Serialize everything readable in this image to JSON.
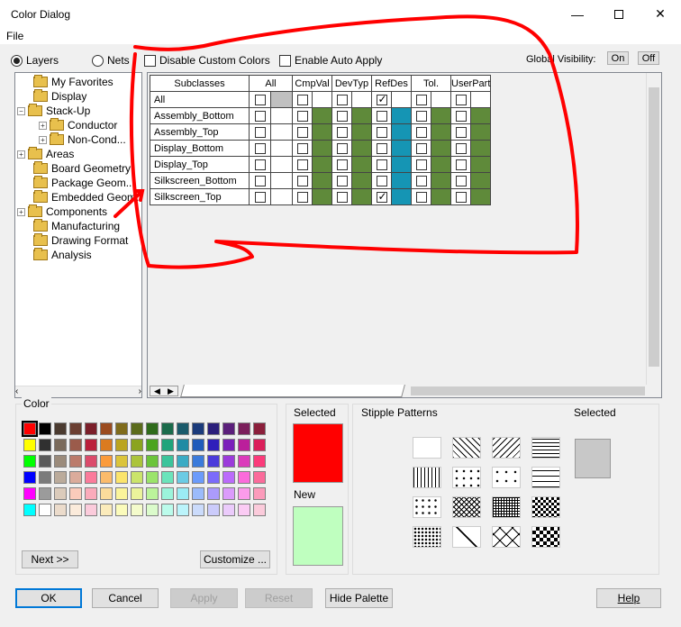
{
  "window": {
    "title": "Color Dialog"
  },
  "menu": {
    "file": "File"
  },
  "top": {
    "layers": "Layers",
    "nets": "Nets",
    "disable_custom": "Disable Custom Colors",
    "auto_apply": "Enable Auto Apply",
    "global_vis": "Global Visibility:",
    "on": "On",
    "off": "Off"
  },
  "tree": [
    {
      "label": "My Favorites",
      "depth": 1,
      "exp": false
    },
    {
      "label": "Display",
      "depth": 1,
      "exp": false
    },
    {
      "label": "Stack-Up",
      "depth": 0,
      "exp": "minus"
    },
    {
      "label": "Conductor",
      "depth": 2,
      "exp": "plus"
    },
    {
      "label": "Non-Cond...",
      "depth": 2,
      "exp": "plus"
    },
    {
      "label": "Areas",
      "depth": 0,
      "exp": "plus"
    },
    {
      "label": "Board Geometry",
      "depth": 1,
      "exp": false
    },
    {
      "label": "Package Geom...",
      "depth": 1,
      "exp": false
    },
    {
      "label": "Embedded Geom...",
      "depth": 1,
      "exp": false
    },
    {
      "label": "Components",
      "depth": 0,
      "exp": "plus"
    },
    {
      "label": "Manufacturing",
      "depth": 1,
      "exp": false
    },
    {
      "label": "Drawing Format",
      "depth": 1,
      "exp": false
    },
    {
      "label": "Analysis",
      "depth": 1,
      "exp": false
    }
  ],
  "grid": {
    "headers": [
      "Subclasses",
      "All",
      "CmpVal",
      "DevTyp",
      "RefDes",
      "Tol.",
      "UserPart"
    ],
    "rows": [
      "All",
      "Assembly_Bottom",
      "Assembly_Top",
      "Display_Bottom",
      "Display_Top",
      "Silkscreen_Bottom",
      "Silkscreen_Top"
    ],
    "col_colors": {
      "CmpVal": "#5f8a3a",
      "DevTyp": "#5f8a3a",
      "RefDes": "#1595b4",
      "Tol.": "#5f8a3a",
      "UserPart": "#5f8a3a"
    },
    "checked": {
      "All": [
        "RefDes"
      ],
      "Silkscreen_Top": [
        "RefDes"
      ]
    }
  },
  "color_panel": {
    "label": "Color",
    "next": "Next >>",
    "customize": "Customize ..."
  },
  "selected_panel": {
    "selected": "Selected",
    "new": "New",
    "selected_color": "#ff0000",
    "new_color": "#bfffbf"
  },
  "stipple_panel": {
    "label": "Stipple Patterns",
    "selected": "Selected"
  },
  "palette": [
    [
      "#ff0000",
      "#000000",
      "#4b3b30",
      "#6b3f32",
      "#7b1f2a",
      "#9b4b1f",
      "#7f6b1b",
      "#5b6b1b",
      "#2f6b1b",
      "#1b6b4b",
      "#1b5b6b",
      "#1b3b7b",
      "#2b1f7b",
      "#5b1f7b",
      "#7b1f5b",
      "#8b1f3b"
    ],
    [
      "#ffff00",
      "#303030",
      "#7b6b5b",
      "#9b5b4b",
      "#bb1f3b",
      "#db7b1f",
      "#bba41f",
      "#8ba41f",
      "#4ba41f",
      "#1fa47b",
      "#1f8ba4",
      "#1f5bbb",
      "#2f1fbb",
      "#7b1fbb",
      "#bb1f9b",
      "#db1f5b"
    ],
    [
      "#00ff00",
      "#5b5b5b",
      "#9b8b7b",
      "#bb7b6b",
      "#db4b6b",
      "#fb9b3b",
      "#dbc43b",
      "#abc43b",
      "#6bc43b",
      "#3bc49b",
      "#3babc4",
      "#3b7bdb",
      "#4b3bdb",
      "#9b3bdb",
      "#db3bbb",
      "#fb3b7b"
    ],
    [
      "#0000ff",
      "#7b7b7b",
      "#bbab9b",
      "#dbab9b",
      "#fb7b9b",
      "#fbbb6b",
      "#fbe46b",
      "#cbe46b",
      "#9be46b",
      "#6be4bb",
      "#6bcbe4",
      "#6b9bfb",
      "#7b6bfb",
      "#bb6bfb",
      "#fb6bdb",
      "#fb6b9b"
    ],
    [
      "#ff00ff",
      "#9b9b9b",
      "#dbcbbb",
      "#fbcbbb",
      "#fbabbb",
      "#fbdb9b",
      "#fbf49b",
      "#ebf49b",
      "#bbf49b",
      "#9bf4db",
      "#9bebf4",
      "#9bbbfb",
      "#ab9bfb",
      "#db9bfb",
      "#fb9beb",
      "#fb9bbb"
    ],
    [
      "#00ffff",
      "#ffffff",
      "#ebdbcb",
      "#fbebdb",
      "#fbcbdb",
      "#fbebbb",
      "#fbfbbb",
      "#f4fbcb",
      "#dbfbcb",
      "#bbfbeb",
      "#bbf4fb",
      "#cbdbfb",
      "#cbcbfb",
      "#ebcbfb",
      "#fbcbf4",
      "#fbcbdb"
    ]
  ],
  "stipples": [
    "solid-white",
    "diag-left",
    "diag-right",
    "horizontal",
    "vertical",
    "dots-small",
    "plus-dots",
    "dashes",
    "dots-sparse",
    "crosshatch",
    "grid",
    "checker",
    "dotted-grid",
    "diamond",
    "wave",
    "checker-large"
  ],
  "buttons": {
    "ok": "OK",
    "cancel": "Cancel",
    "apply": "Apply",
    "reset": "Reset",
    "hide_palette": "Hide Palette",
    "help": "Help"
  }
}
